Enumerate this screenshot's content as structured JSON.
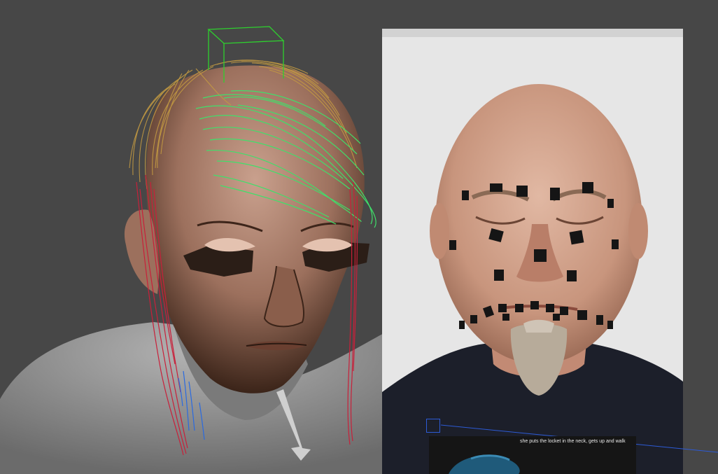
{
  "viewport": {
    "background_color": "#474747",
    "subtitle": "she puts the locket in the neck, gets up and walk",
    "colors": {
      "skin": "#b68773",
      "skin_shadow": "#3b2419",
      "body": "#9a9a9a",
      "hair_guide_gold": "#c39a42",
      "hair_guide_green": "#3fe06a",
      "hair_guide_red": "#c8203a",
      "hair_guide_blue": "#2a6ae0",
      "bounding_box": "#2ed12e",
      "reference_background": "#e6e6e6",
      "tracking_marker": "#151515"
    }
  },
  "icons": [
    "bounding-box-icon",
    "manipulator-handle-icon",
    "direction-cone-icon"
  ]
}
